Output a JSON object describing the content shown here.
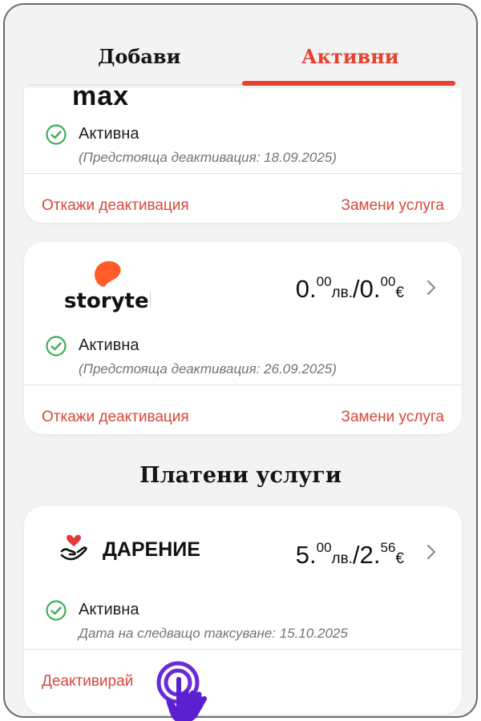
{
  "tabs": {
    "add": "Добави",
    "active": "Активни"
  },
  "colors": {
    "accent": "#e8412f",
    "status_green": "#3fae5a",
    "cursor_purple": "#5a1fd1"
  },
  "cards": [
    {
      "logo_text": "max",
      "status": "Активна",
      "note": "(Предстояща деактивация: 18.09.2025)",
      "action_left": "Откажи деактивация",
      "action_right": "Замени услуга"
    },
    {
      "logo_text": "storytel",
      "price_lv_int": "0.",
      "price_lv_dec": "00",
      "price_lv_cur": "лв.",
      "price_sep": "/",
      "price_eur_int": "0.",
      "price_eur_dec": "00",
      "price_eur_cur": "€",
      "status": "Активна",
      "note": "(Предстояща деактивация: 26.09.2025)",
      "action_left": "Откажи деактивация",
      "action_right": "Замени услуга"
    },
    {
      "logo_text": "ДАРЕНИЕ",
      "price_lv_int": "5.",
      "price_lv_dec": "00",
      "price_lv_cur": "лв.",
      "price_sep": "/",
      "price_eur_int": "2.",
      "price_eur_dec": "56",
      "price_eur_cur": "€",
      "status": "Активна",
      "note": "Дата на следващо таксуване: 15.10.2025",
      "action_left": "Деактивирай"
    }
  ],
  "section_title": "Платени услуги",
  "icons": [
    "check-circle-icon",
    "chevron-right-icon",
    "storytel-logo",
    "donation-logo",
    "pointer-hand-icon"
  ]
}
